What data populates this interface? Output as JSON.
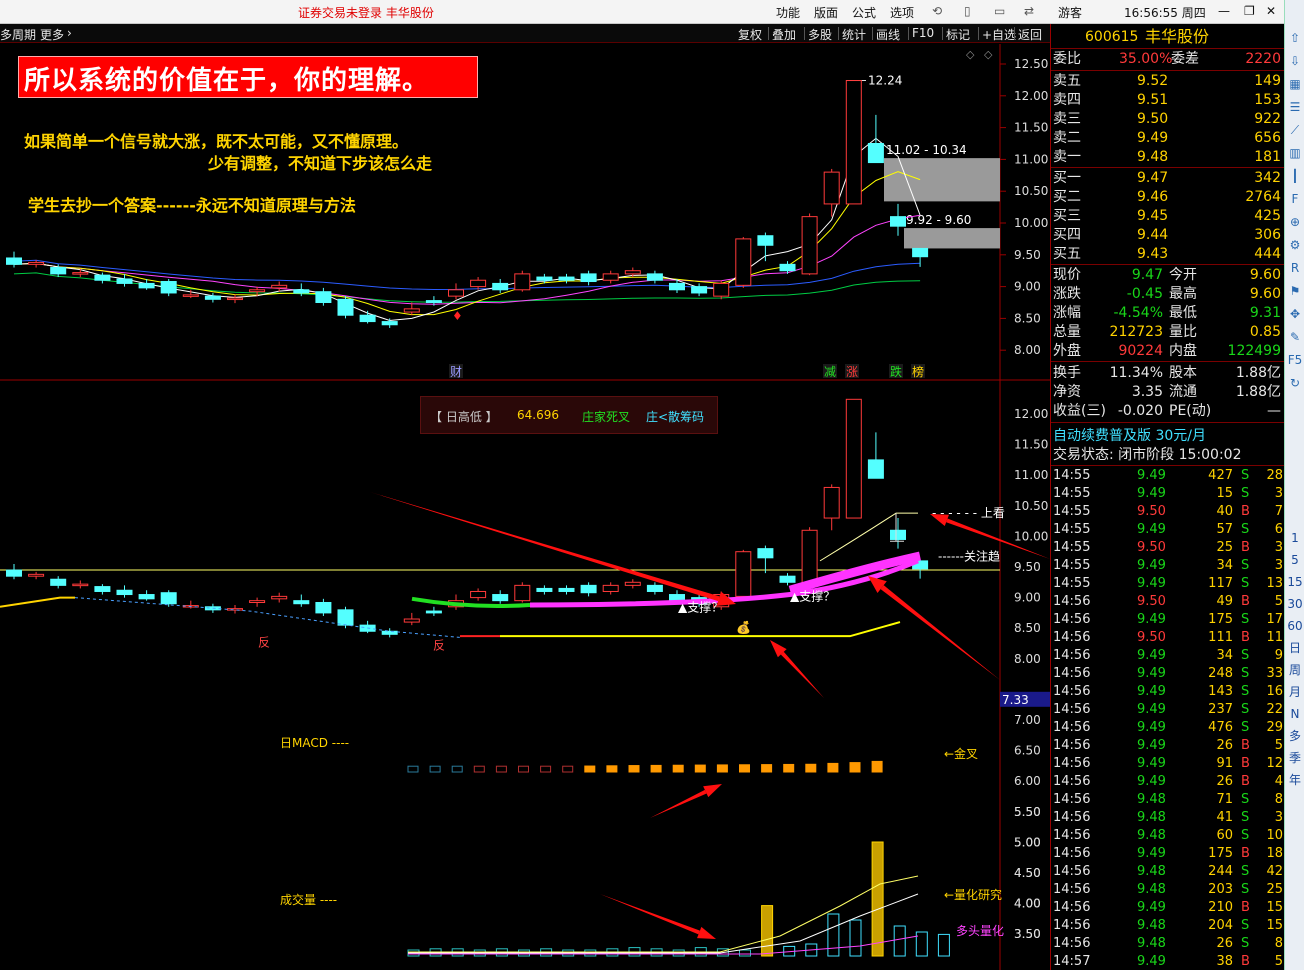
{
  "titlebar": {
    "center_text": "证券交易未登录  丰华股份",
    "menu": [
      "功能",
      "版面",
      "公式",
      "选项"
    ],
    "user": "游客",
    "time": "16:56:55 周四"
  },
  "toolbar": {
    "left": [
      "多周期",
      "更多"
    ],
    "right": [
      "复权",
      "叠加",
      "多股",
      "统计",
      "画线",
      "F10",
      "标记",
      "+自选",
      "返回"
    ]
  },
  "overlay": {
    "headline": "所以系统的价值在于，你的理解。",
    "line1": "如果简单一个信号就大涨，既不太可能，又不懂原理。",
    "line2": "少有调整，不知道下步该怎么走",
    "line3": "学生去抄一个答案------永远不知道原理与方法"
  },
  "chart_data": [
    {
      "type": "candlestick",
      "title": "",
      "ylim": [
        7.9,
        12.6
      ],
      "yticks": [
        "12.50",
        "12.00",
        "11.50",
        "11.00",
        "10.50",
        "10.00",
        "9.50",
        "9.00",
        "8.50",
        "8.00"
      ],
      "annotations": [
        "12.24",
        "11.02 - 10.34",
        "9.92 - 9.60"
      ],
      "event_markers": [
        "财",
        "减",
        "涨",
        "跌",
        "榜"
      ],
      "candles": [
        [
          9.45,
          9.35,
          9.55,
          9.3
        ],
        [
          9.35,
          9.38,
          9.42,
          9.3
        ],
        [
          9.3,
          9.2,
          9.35,
          9.15
        ],
        [
          9.2,
          9.22,
          9.28,
          9.15
        ],
        [
          9.18,
          9.1,
          9.22,
          9.05
        ],
        [
          9.12,
          9.05,
          9.2,
          9.0
        ],
        [
          9.05,
          8.98,
          9.12,
          8.95
        ],
        [
          9.08,
          8.9,
          9.12,
          8.85
        ],
        [
          8.85,
          8.87,
          8.95,
          8.82
        ],
        [
          8.85,
          8.8,
          8.9,
          8.75
        ],
        [
          8.8,
          8.82,
          8.88,
          8.74
        ],
        [
          8.92,
          8.95,
          9.0,
          8.85
        ],
        [
          8.98,
          9.02,
          9.08,
          8.92
        ],
        [
          8.95,
          8.9,
          9.05,
          8.85
        ],
        [
          8.92,
          8.75,
          8.98,
          8.7
        ],
        [
          8.8,
          8.55,
          8.85,
          8.5
        ],
        [
          8.55,
          8.45,
          8.62,
          8.42
        ],
        [
          8.45,
          8.4,
          8.5,
          8.35
        ],
        [
          8.6,
          8.65,
          8.75,
          8.55
        ],
        [
          8.78,
          8.75,
          8.85,
          8.7
        ],
        [
          8.85,
          8.95,
          9.05,
          8.8
        ],
        [
          9.0,
          9.1,
          9.15,
          8.95
        ],
        [
          9.05,
          8.95,
          9.12,
          8.9
        ],
        [
          8.95,
          9.2,
          9.25,
          8.92
        ],
        [
          9.15,
          9.1,
          9.2,
          9.05
        ],
        [
          9.15,
          9.1,
          9.2,
          9.05
        ],
        [
          9.2,
          9.08,
          9.25,
          9.02
        ],
        [
          9.1,
          9.2,
          9.25,
          9.05
        ],
        [
          9.2,
          9.25,
          9.3,
          9.15
        ],
        [
          9.2,
          9.1,
          9.25,
          9.05
        ],
        [
          9.05,
          8.95,
          9.12,
          8.9
        ],
        [
          9.0,
          8.9,
          9.05,
          8.85
        ],
        [
          8.85,
          9.05,
          9.1,
          8.8
        ],
        [
          9.02,
          9.75,
          9.78,
          8.98
        ],
        [
          9.8,
          9.65,
          9.85,
          9.4
        ],
        [
          9.35,
          9.25,
          9.4,
          9.2
        ],
        [
          9.2,
          10.1,
          10.15,
          9.18
        ],
        [
          10.3,
          10.8,
          10.85,
          10.1
        ],
        [
          10.3,
          12.24,
          12.24,
          10.3
        ],
        [
          11.25,
          10.95,
          11.7,
          10.95
        ],
        [
          10.1,
          9.95,
          10.3,
          9.8
        ],
        [
          9.6,
          9.47,
          9.6,
          9.31
        ]
      ]
    },
    {
      "type": "candlestick",
      "title": "",
      "ylim": [
        7.5,
        12.5
      ],
      "yticks": [
        "12.00",
        "11.50",
        "11.00",
        "10.50",
        "10.00",
        "9.50",
        "9.00",
        "8.50",
        "8.00"
      ],
      "legend_box": [
        "【 日高低 】",
        "64.696",
        "庄家死叉",
        "庄<散筹码"
      ],
      "labels": [
        "上看",
        "关注趋",
        "▲支撑？",
        "▲支撑？",
        "反",
        "反",
        "7.33"
      ]
    },
    {
      "type": "bar",
      "title": "日MACD ----",
      "yticks": [
        "7.00",
        "6.50",
        "6.00"
      ],
      "labels": [
        "←金叉"
      ],
      "values": [
        0.1,
        0.1,
        0.1,
        0.1,
        0.1,
        0.1,
        0.1,
        0.1,
        0.12,
        0.15,
        0.18,
        0.2,
        0.22,
        0.24,
        0.26,
        0.28,
        0.3,
        0.32,
        0.34,
        0.45,
        0.55,
        0.7
      ]
    },
    {
      "type": "bar",
      "title": "成交量 ----",
      "yticks": [
        "5.50",
        "5.00",
        "4.50",
        "4.00",
        "3.50"
      ],
      "labels": [
        "←量化研究",
        "多头量化"
      ],
      "values": [
        0.5,
        0.6,
        0.6,
        0.5,
        0.6,
        0.5,
        0.6,
        0.5,
        0.5,
        0.6,
        0.7,
        0.6,
        0.5,
        0.7,
        0.6,
        0.5,
        4.2,
        0.8,
        1.0,
        3.5,
        3.0,
        9.5,
        2.5,
        2.0,
        1.8
      ]
    }
  ],
  "quote": {
    "code": "600615",
    "name": "丰华股份",
    "weibi_label": "委比",
    "weibi": "35.00%",
    "weicha_label": "委差",
    "weicha": "2220",
    "asks": [
      {
        "label": "卖五",
        "price": "9.52",
        "vol": "149"
      },
      {
        "label": "卖四",
        "price": "9.51",
        "vol": "153"
      },
      {
        "label": "卖三",
        "price": "9.50",
        "vol": "922"
      },
      {
        "label": "卖二",
        "price": "9.49",
        "vol": "656"
      },
      {
        "label": "卖一",
        "price": "9.48",
        "vol": "181"
      }
    ],
    "bids": [
      {
        "label": "买一",
        "price": "9.47",
        "vol": "342"
      },
      {
        "label": "买二",
        "price": "9.46",
        "vol": "2764"
      },
      {
        "label": "买三",
        "price": "9.45",
        "vol": "425"
      },
      {
        "label": "买四",
        "price": "9.44",
        "vol": "306"
      },
      {
        "label": "买五",
        "price": "9.43",
        "vol": "444"
      }
    ],
    "stats": [
      {
        "l1": "现价",
        "v1": "9.47",
        "l2": "今开",
        "v2": "9.60"
      },
      {
        "l1": "涨跌",
        "v1": "-0.45",
        "l2": "最高",
        "v2": "9.60"
      },
      {
        "l1": "涨幅",
        "v1": "-4.54%",
        "l2": "最低",
        "v2": "9.31"
      },
      {
        "l1": "总量",
        "v1": "212723",
        "l2": "量比",
        "v2": "0.85"
      },
      {
        "l1": "外盘",
        "v1": "90224",
        "l2": "内盘",
        "v2": "122499"
      }
    ],
    "stats2": [
      {
        "l1": "换手",
        "v1": "11.34%",
        "l2": "股本",
        "v2": "1.88亿"
      },
      {
        "l1": "净资",
        "v1": "3.35",
        "l2": "流通",
        "v2": "1.88亿"
      },
      {
        "l1": "收益(三)",
        "v1": "-0.020",
        "l2": "PE(动)",
        "v2": "—"
      }
    ],
    "ad": "自动续费普及版  30元/月",
    "status": "交易状态: 闭市阶段 15:00:02"
  },
  "ticks": [
    [
      "14:55",
      "9.49",
      "427",
      "S",
      "28"
    ],
    [
      "14:55",
      "9.49",
      "15",
      "S",
      "3"
    ],
    [
      "14:55",
      "9.50",
      "40",
      "B",
      "7"
    ],
    [
      "14:55",
      "9.49",
      "57",
      "S",
      "6"
    ],
    [
      "14:55",
      "9.50",
      "25",
      "B",
      "3"
    ],
    [
      "14:55",
      "9.49",
      "34",
      "S",
      "3"
    ],
    [
      "14:55",
      "9.49",
      "117",
      "S",
      "13"
    ],
    [
      "14:56",
      "9.50",
      "49",
      "B",
      "5"
    ],
    [
      "14:56",
      "9.49",
      "175",
      "S",
      "17"
    ],
    [
      "14:56",
      "9.50",
      "111",
      "B",
      "11"
    ],
    [
      "14:56",
      "9.49",
      "34",
      "S",
      "9"
    ],
    [
      "14:56",
      "9.49",
      "248",
      "S",
      "33"
    ],
    [
      "14:56",
      "9.49",
      "143",
      "S",
      "16"
    ],
    [
      "14:56",
      "9.49",
      "237",
      "S",
      "22"
    ],
    [
      "14:56",
      "9.49",
      "476",
      "S",
      "29"
    ],
    [
      "14:56",
      "9.49",
      "26",
      "B",
      "5"
    ],
    [
      "14:56",
      "9.49",
      "91",
      "B",
      "12"
    ],
    [
      "14:56",
      "9.49",
      "26",
      "B",
      "4"
    ],
    [
      "14:56",
      "9.48",
      "71",
      "S",
      "8"
    ],
    [
      "14:56",
      "9.48",
      "41",
      "S",
      "3"
    ],
    [
      "14:56",
      "9.48",
      "60",
      "S",
      "10"
    ],
    [
      "14:56",
      "9.49",
      "175",
      "B",
      "18"
    ],
    [
      "14:56",
      "9.48",
      "244",
      "S",
      "42"
    ],
    [
      "14:56",
      "9.48",
      "203",
      "S",
      "25"
    ],
    [
      "14:56",
      "9.49",
      "210",
      "B",
      "15"
    ],
    [
      "14:56",
      "9.48",
      "204",
      "S",
      "15"
    ],
    [
      "14:56",
      "9.48",
      "26",
      "S",
      "8"
    ],
    [
      "14:57",
      "9.49",
      "38",
      "B",
      "5"
    ]
  ],
  "sidebar_icons": [
    "up-arrow-icon",
    "down-arrow-icon",
    "chart-icon",
    "list-icon",
    "trend-icon",
    "bars-icon",
    "candle-icon",
    "f10-icon",
    "zoom-icon",
    "settings-icon",
    "rsi-icon",
    "flag-icon",
    "move-icon",
    "pen-icon",
    "f5-icon",
    "refresh-icon"
  ],
  "sidebar_labels": [
    "1",
    "5",
    "15",
    "30",
    "60",
    "日",
    "周",
    "月",
    "N",
    "多",
    "季",
    "年"
  ],
  "colors": {
    "up": "#ff3a3a",
    "down": "#54ffff",
    "ma5": "#ffffff",
    "ma10": "#ffff00",
    "ma20": "#ff44ff",
    "ma60": "#2b5cff",
    "ma120": "#00cc44"
  }
}
